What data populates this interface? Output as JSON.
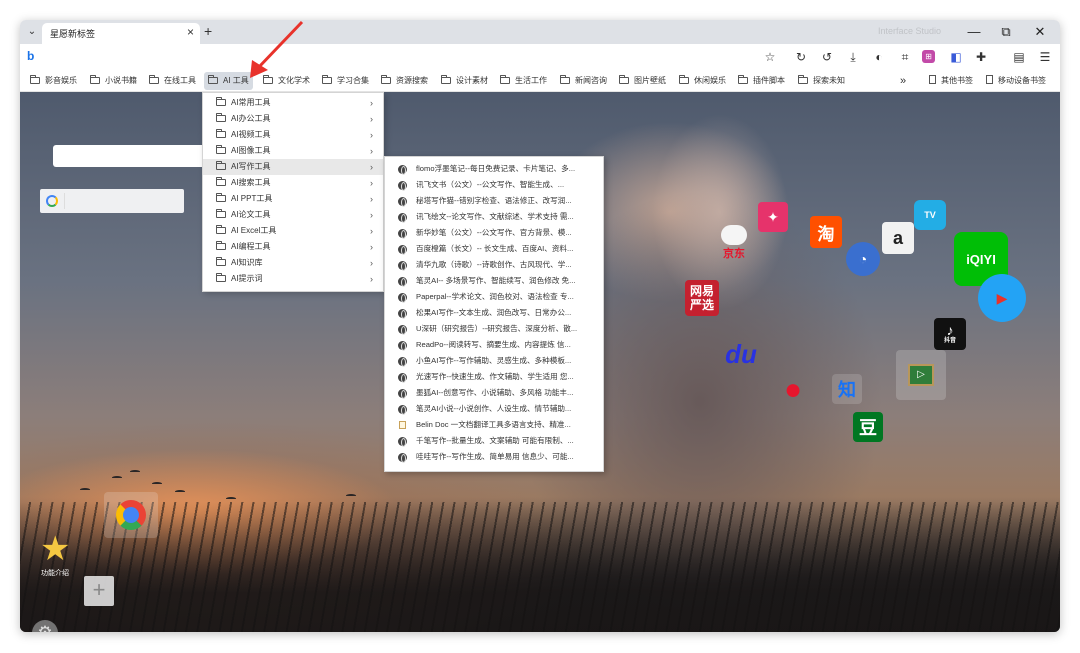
{
  "window": {
    "tab_title": "星愿新标签",
    "tab_close": "×",
    "new_tab": "+",
    "faded_title_text": "Interface Studio",
    "controls": [
      "—",
      "⧉",
      "✕"
    ]
  },
  "toolbar": {
    "logo": "b",
    "icons": [
      "star-icon",
      "refresh-icon",
      "history-icon",
      "download-icon",
      "theme-icon",
      "crop-icon",
      "translate-icon",
      "screenshot-icon",
      "extensions-icon",
      "sidebar-icon",
      "menu-icon"
    ]
  },
  "bookmarks": {
    "items": [
      "影音娱乐",
      "小说书籍",
      "在线工具",
      "AI 工具",
      "文化学术",
      "学习合集",
      "资源搜索",
      "设计素材",
      "生活工作",
      "新闻咨询",
      "图片壁纸",
      "休闲娱乐",
      "插件脚本",
      "探索未知"
    ],
    "overflow": "»",
    "other": "其他书签",
    "mobile": "移动设备书签"
  },
  "ai_menu": {
    "items": [
      "AI常用工具",
      "AI办公工具",
      "AI视频工具",
      "AI图像工具",
      "AI写作工具",
      "AI搜索工具",
      "AI PPT工具",
      "AI论文工具",
      "AI Excel工具",
      "AI编程工具",
      "AI知识库",
      "AI提示词"
    ],
    "highlighted": "AI写作工具"
  },
  "writing_menu": {
    "items": [
      "flomo浮墨笔记--每日免费记录、卡片笔记、多...",
      "讯飞文书（公文）--公文写作、智能生成、...",
      "秘塔写作猫--错别字检查、语法修正、改写润...",
      "讯飞绘文--论文写作、文献综述、学术支持 需...",
      "新华妙笔（公文）--公文写作、官方背景、模...",
      "百度橙篇（长文）-- 长文生成、百度AI、资料...",
      "清华九歌（诗歌）--诗歌创作、古风现代、学...",
      "笔灵AI-- 多场景写作、智能续写、润色修改 免...",
      "Paperpal--学术论文、润色校对、语法检查 专...",
      "松果AI写作--文本生成、润色改写、日常办公...",
      "U深研（研究报告）--研究报告、深度分析、散...",
      "ReadPo--阅读转写、摘要生成、内容提炼 信...",
      "小鱼AI写作--写作辅助、灵感生成、多种模板...",
      "光速写作--快速生成、作文辅助、学生适用 您...",
      "墨狐AI--创意写作、小说辅助、多风格 功能丰...",
      "笔灵AI小说--小说创作、人设生成、情节辅助...",
      "Belin Doc 一文档翻译工具多语言支持、精准...",
      "千笔写作--批量生成、文案辅助 可能有限制、...",
      "哇哇写作--写作生成、简单易用 信息少、可能..."
    ]
  },
  "apps": {
    "tmall_face": "✦",
    "taobao": "淘",
    "amazon": "a",
    "bilibili_tv": "TV",
    "iqiyi": "iQIYI",
    "netease": "网易\n严选",
    "jd": "京东",
    "baidu": "du",
    "weibo": "●",
    "zhihu": "知",
    "douban": "豆",
    "douyin": "抖音",
    "douyin_logo": "♪"
  },
  "home": {
    "star_label": "功能介绍",
    "add_symbol": "+",
    "settings_symbol": "⚙"
  },
  "colors": {
    "accent": "#1a73e8",
    "taobao": "#ff5000",
    "iqiyi": "#00be06",
    "baidu": "#2932e1",
    "weibo": "#e6162d",
    "douban": "#007722",
    "zhihu": "#1772f6",
    "arrow": "#e8322b"
  }
}
